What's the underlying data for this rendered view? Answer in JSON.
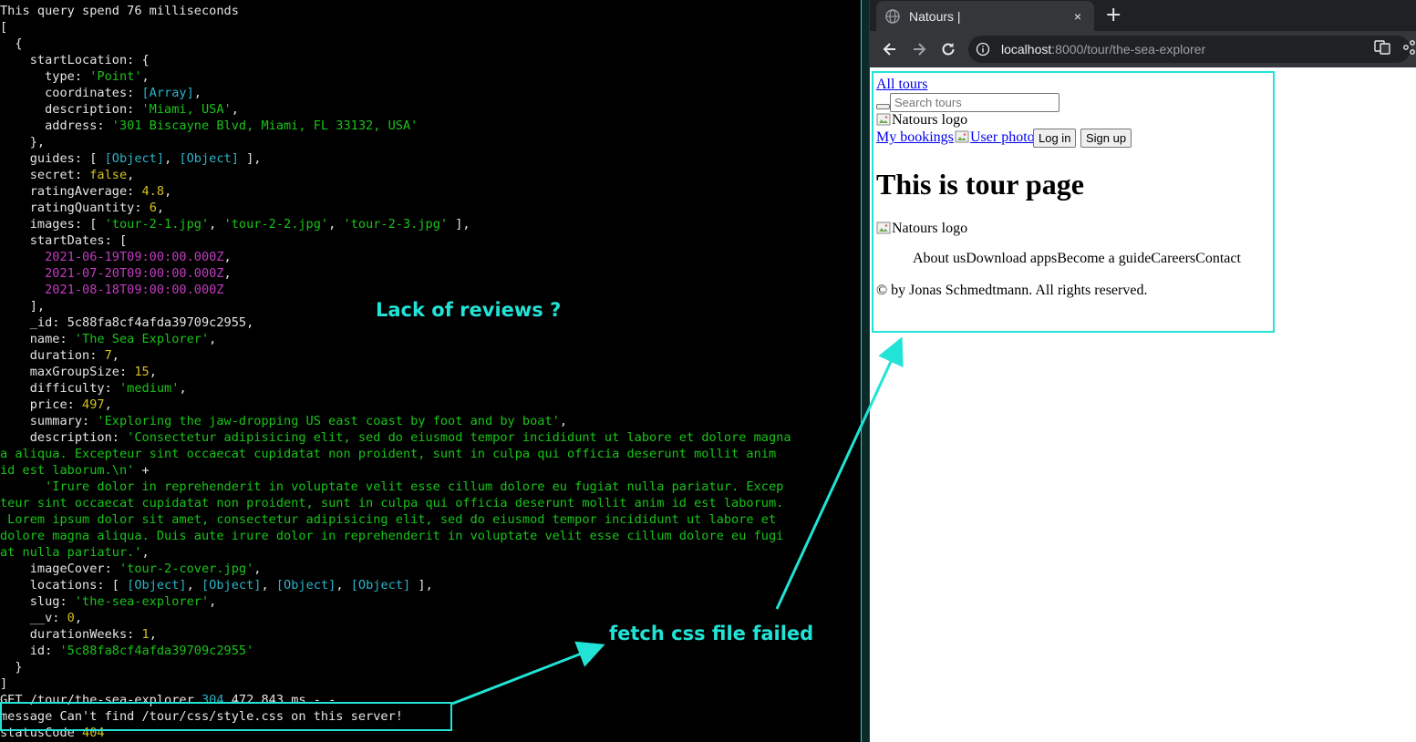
{
  "terminal": {
    "lines": [
      [
        {
          "t": "This query spend 76 milliseconds",
          "c": "key"
        }
      ],
      [
        {
          "t": "[",
          "c": "key"
        }
      ],
      [
        {
          "t": "  {",
          "c": "key"
        }
      ],
      [
        {
          "t": "    startLocation: {",
          "c": "key"
        }
      ],
      [
        {
          "t": "      type: ",
          "c": "key"
        },
        {
          "t": "'Point'",
          "c": "str"
        },
        {
          "t": ",",
          "c": "key"
        }
      ],
      [
        {
          "t": "      coordinates: ",
          "c": "key"
        },
        {
          "t": "[Array]",
          "c": "obj"
        },
        {
          "t": ",",
          "c": "key"
        }
      ],
      [
        {
          "t": "      description: ",
          "c": "key"
        },
        {
          "t": "'Miami, USA'",
          "c": "str"
        },
        {
          "t": ",",
          "c": "key"
        }
      ],
      [
        {
          "t": "      address: ",
          "c": "key"
        },
        {
          "t": "'301 Biscayne Blvd, Miami, FL 33132, USA'",
          "c": "str"
        }
      ],
      [
        {
          "t": "    },",
          "c": "key"
        }
      ],
      [
        {
          "t": "    guides: [ ",
          "c": "key"
        },
        {
          "t": "[Object]",
          "c": "obj"
        },
        {
          "t": ", ",
          "c": "key"
        },
        {
          "t": "[Object]",
          "c": "obj"
        },
        {
          "t": " ],",
          "c": "key"
        }
      ],
      [
        {
          "t": "    secret: ",
          "c": "key"
        },
        {
          "t": "false",
          "c": "num"
        },
        {
          "t": ",",
          "c": "key"
        }
      ],
      [
        {
          "t": "    ratingAverage: ",
          "c": "key"
        },
        {
          "t": "4.8",
          "c": "num"
        },
        {
          "t": ",",
          "c": "key"
        }
      ],
      [
        {
          "t": "    ratingQuantity: ",
          "c": "key"
        },
        {
          "t": "6",
          "c": "num"
        },
        {
          "t": ",",
          "c": "key"
        }
      ],
      [
        {
          "t": "    images: [ ",
          "c": "key"
        },
        {
          "t": "'tour-2-1.jpg'",
          "c": "str"
        },
        {
          "t": ", ",
          "c": "key"
        },
        {
          "t": "'tour-2-2.jpg'",
          "c": "str"
        },
        {
          "t": ", ",
          "c": "key"
        },
        {
          "t": "'tour-2-3.jpg'",
          "c": "str"
        },
        {
          "t": " ],",
          "c": "key"
        }
      ],
      [
        {
          "t": "    startDates: [",
          "c": "key"
        }
      ],
      [
        {
          "t": "      2021-06-19T09:00:00.000Z",
          "c": "date"
        },
        {
          "t": ",",
          "c": "key"
        }
      ],
      [
        {
          "t": "      2021-07-20T09:00:00.000Z",
          "c": "date"
        },
        {
          "t": ",",
          "c": "key"
        }
      ],
      [
        {
          "t": "      2021-08-18T09:00:00.000Z",
          "c": "date"
        }
      ],
      [
        {
          "t": "    ],",
          "c": "key"
        }
      ],
      [
        {
          "t": "    _id: 5c88fa8cf4afda39709c2955,",
          "c": "key"
        }
      ],
      [
        {
          "t": "    name: ",
          "c": "key"
        },
        {
          "t": "'The Sea Explorer'",
          "c": "str"
        },
        {
          "t": ",",
          "c": "key"
        }
      ],
      [
        {
          "t": "    duration: ",
          "c": "key"
        },
        {
          "t": "7",
          "c": "num"
        },
        {
          "t": ",",
          "c": "key"
        }
      ],
      [
        {
          "t": "    maxGroupSize: ",
          "c": "key"
        },
        {
          "t": "15",
          "c": "num"
        },
        {
          "t": ",",
          "c": "key"
        }
      ],
      [
        {
          "t": "    difficulty: ",
          "c": "key"
        },
        {
          "t": "'medium'",
          "c": "str"
        },
        {
          "t": ",",
          "c": "key"
        }
      ],
      [
        {
          "t": "    price: ",
          "c": "key"
        },
        {
          "t": "497",
          "c": "num"
        },
        {
          "t": ",",
          "c": "key"
        }
      ],
      [
        {
          "t": "    summary: ",
          "c": "key"
        },
        {
          "t": "'Exploring the jaw-dropping US east coast by foot and by boat'",
          "c": "str"
        },
        {
          "t": ",",
          "c": "key"
        }
      ],
      [
        {
          "t": "    description: ",
          "c": "key"
        },
        {
          "t": "'Consectetur adipisicing elit, sed do eiusmod tempor incididunt ut labore et dolore magna",
          "c": "str"
        }
      ],
      [
        {
          "t": "a aliqua. Excepteur sint occaecat cupidatat non proident, sunt in culpa qui officia deserunt mollit anim",
          "c": "str"
        }
      ],
      [
        {
          "t": "id est laborum.\\n'",
          "c": "str"
        },
        {
          "t": " +",
          "c": "key"
        }
      ],
      [
        {
          "t": "      'Irure dolor in reprehenderit in voluptate velit esse cillum dolore eu fugiat nulla pariatur. Excep",
          "c": "str"
        }
      ],
      [
        {
          "t": "teur sint occaecat cupidatat non proident, sunt in culpa qui officia deserunt mollit anim id est laborum.",
          "c": "str"
        }
      ],
      [
        {
          "t": " Lorem ipsum dolor sit amet, consectetur adipisicing elit, sed do eiusmod tempor incididunt ut labore et",
          "c": "str"
        }
      ],
      [
        {
          "t": "dolore magna aliqua. Duis aute irure dolor in reprehenderit in voluptate velit esse cillum dolore eu fugi",
          "c": "str"
        }
      ],
      [
        {
          "t": "at nulla pariatur.'",
          "c": "str"
        },
        {
          "t": ",",
          "c": "key"
        }
      ],
      [
        {
          "t": "    imageCover: ",
          "c": "key"
        },
        {
          "t": "'tour-2-cover.jpg'",
          "c": "str"
        },
        {
          "t": ",",
          "c": "key"
        }
      ],
      [
        {
          "t": "    locations: [ ",
          "c": "key"
        },
        {
          "t": "[Object]",
          "c": "obj"
        },
        {
          "t": ", ",
          "c": "key"
        },
        {
          "t": "[Object]",
          "c": "obj"
        },
        {
          "t": ", ",
          "c": "key"
        },
        {
          "t": "[Object]",
          "c": "obj"
        },
        {
          "t": ", ",
          "c": "key"
        },
        {
          "t": "[Object]",
          "c": "obj"
        },
        {
          "t": " ],",
          "c": "key"
        }
      ],
      [
        {
          "t": "    slug: ",
          "c": "key"
        },
        {
          "t": "'the-sea-explorer'",
          "c": "str"
        },
        {
          "t": ",",
          "c": "key"
        }
      ],
      [
        {
          "t": "    __v: ",
          "c": "key"
        },
        {
          "t": "0",
          "c": "num"
        },
        {
          "t": ",",
          "c": "key"
        }
      ],
      [
        {
          "t": "    durationWeeks: ",
          "c": "key"
        },
        {
          "t": "1",
          "c": "num"
        },
        {
          "t": ",",
          "c": "key"
        }
      ],
      [
        {
          "t": "    id: ",
          "c": "key"
        },
        {
          "t": "'5c88fa8cf4afda39709c2955'",
          "c": "str"
        }
      ],
      [
        {
          "t": "  }",
          "c": "key"
        }
      ],
      [
        {
          "t": "]",
          "c": "key"
        }
      ],
      [
        {
          "t": "GET /tour/the-sea-explorer ",
          "c": "key"
        },
        {
          "t": "304",
          "c": "obj"
        },
        {
          "t": " 472.843 ms - -",
          "c": "key"
        }
      ],
      [
        {
          "t": "message Can't find /tour/css/style.css on this server!",
          "c": "key"
        }
      ],
      [
        {
          "t": "statusCode ",
          "c": "key"
        },
        {
          "t": "404",
          "c": "num"
        }
      ]
    ]
  },
  "browser": {
    "tab_title": "Natours |",
    "tab_close": "×",
    "new_tab": "+",
    "url_host": "localhost",
    "url_path": ":8000/tour/the-sea-explorer"
  },
  "page": {
    "all_tours": "All tours",
    "search_placeholder": "Search tours",
    "logo_alt": "Natours logo",
    "my_bookings": "My bookings",
    "user_photo_alt": "User photo",
    "login": "Log in",
    "signup": "Sign up",
    "heading": "This is tour page",
    "footer_logo_alt": "Natours logo",
    "footer_links": [
      "About us",
      "Download apps",
      "Become a guide",
      "Careers",
      "Contact"
    ],
    "copyright": "© by Jonas Schmedtmann. All rights reserved."
  },
  "annotations": {
    "lack_reviews": "Lack of reviews ?",
    "fetch_css_failed": "fetch css file failed"
  },
  "colors": {
    "annotation": "#21e3d6",
    "terminal_bg": "#000000",
    "string": "#19c419",
    "number": "#d6c21e",
    "date": "#c23bc2",
    "object": "#2bb3c9"
  }
}
